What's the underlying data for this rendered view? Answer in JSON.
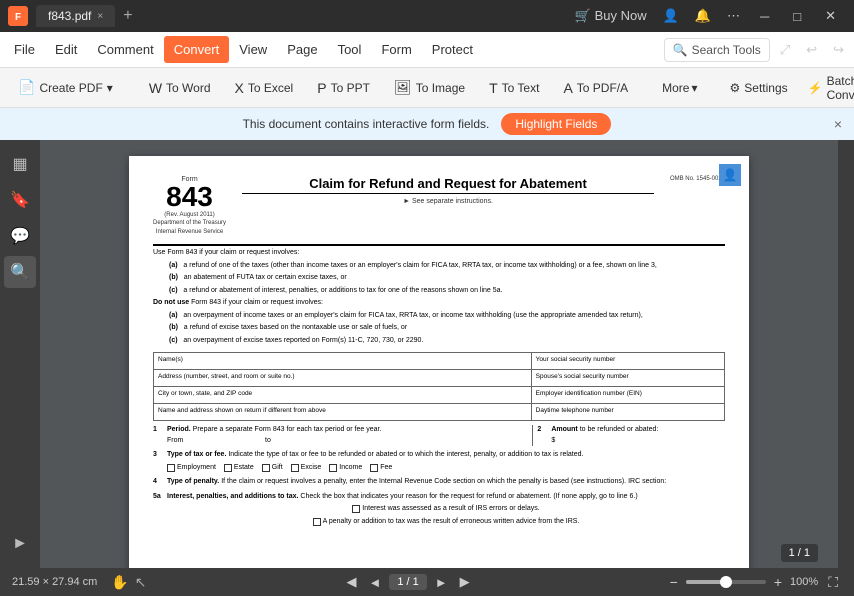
{
  "titlebar": {
    "filename": "f843.pdf",
    "app_name": "Foxit PDF Editor",
    "close_tab": "×",
    "add_tab": "+"
  },
  "menubar": {
    "items": [
      {
        "id": "file",
        "label": "File"
      },
      {
        "id": "edit",
        "label": "Edit"
      },
      {
        "id": "comment",
        "label": "Comment"
      },
      {
        "id": "convert",
        "label": "Convert",
        "active": true
      },
      {
        "id": "view",
        "label": "View"
      },
      {
        "id": "page",
        "label": "Page"
      },
      {
        "id": "tool",
        "label": "Tool"
      },
      {
        "id": "form",
        "label": "Form"
      },
      {
        "id": "protect",
        "label": "Protect"
      }
    ],
    "search_tools": "Search Tools"
  },
  "toolbar": {
    "create_pdf": "Create PDF",
    "to_word": "To Word",
    "to_excel": "To Excel",
    "to_ppt": "To PPT",
    "to_image": "To Image",
    "to_text": "To Text",
    "to_pdf_a": "To PDF/A",
    "more": "More",
    "settings": "Settings",
    "batch_convert": "Batch Conve..."
  },
  "notification": {
    "message": "This document contains interactive form fields.",
    "button": "Highlight Fields",
    "close": "×"
  },
  "form": {
    "form_label": "Form",
    "form_number": "843",
    "rev_date": "(Rev. August 2011)",
    "dept_line1": "Department of the Treasury",
    "dept_line2": "Internal Revenue Service",
    "title": "Claim for Refund and Request for Abatement",
    "subtitle": "► See separate instructions.",
    "omb": "OMB No. 1545-0024",
    "instructions": [
      "Use Form 843 if your claim or request involves:",
      "(a)   a refund of one of the taxes (other than income taxes or an employer's claim for FICA tax, RRTA tax, or income tax withholding) or a fee, shown on line 3,",
      "(b)   an abatement of FUTA tax or certain excise taxes, or",
      "(c)   a refund or abatement of interest, penalties, or additions to tax for one of the reasons shown on line 5a.",
      "Do not use Form 843 if your claim or request involves:",
      "(a)   an overpayment of income taxes or an employer's claim for FICA tax, RRTA tax, or income tax withholding (use the appropriate amended tax return),",
      "(b)   a refund of excise taxes based on the nontaxable use or sale of fuels, or",
      "(c)   an overpayment of excise taxes reported on Form(s) 11-C, 720, 730, or 2290."
    ],
    "fields": {
      "name_label": "Name(s)",
      "ssn_label": "Your social security number",
      "address_label": "Address (number, street, and room or suite no.)",
      "spouse_ssn_label": "Spouse's social security number",
      "city_label": "City or town, state, and ZIP code",
      "ein_label": "Employer identification number (EIN)",
      "name_return_label": "Name and address shown on return if different from above",
      "daytime_phone_label": "Daytime telephone number"
    },
    "sections": [
      {
        "num": "1",
        "label": "Period.",
        "text": "Prepare a separate Form 843 for each tax period or fee year.",
        "subtext": "From                                         to"
      },
      {
        "num": "2",
        "label": "Amount",
        "text": "to be refunded or abated:",
        "subtext": "$"
      },
      {
        "num": "3",
        "label": "Type of tax or fee.",
        "text": "Indicate the type of tax or fee to be refunded or abated or to which the interest, penalty, or addition to tax is related."
      },
      {
        "num": "4",
        "label": "Type of penalty.",
        "text": "If the claim or request involves a penalty, enter the Internal Revenue Code section on which the penalty is based (see instructions). IRC section:"
      },
      {
        "num": "5a",
        "label": "Interest, penalties, and additions to tax.",
        "text": "Check the box that indicates your reason for the request for refund or abatement. (If none apply, go to line 6.)"
      }
    ],
    "checkboxes_row3": [
      "Employment",
      "Estate",
      "Gift",
      "Excise",
      "Income",
      "Fee"
    ],
    "checkboxes_row5a": [
      "Interest was assessed as a result of IRS errors or delays.",
      "A penalty or addition to tax was the result of erroneous written advice from the IRS."
    ]
  },
  "bottom": {
    "dimensions": "21.59 × 27.94 cm",
    "page_current": "1",
    "page_total": "1",
    "page_display": "1 / 1",
    "zoom_percent": "100%",
    "zoom_level": 100
  },
  "icons": {
    "thumbnail": "▦",
    "bookmark": "🔖",
    "comment": "💬",
    "search": "🔍",
    "hand": "✋",
    "cursor": "↖",
    "prev_page": "◄",
    "next_page": "►",
    "first_page": "◀",
    "last_page": "▶",
    "zoom_out": "−",
    "zoom_in": "+",
    "fit": "⛶",
    "search_icon": "🔍",
    "gear": "⚙",
    "expand": "⤢"
  }
}
